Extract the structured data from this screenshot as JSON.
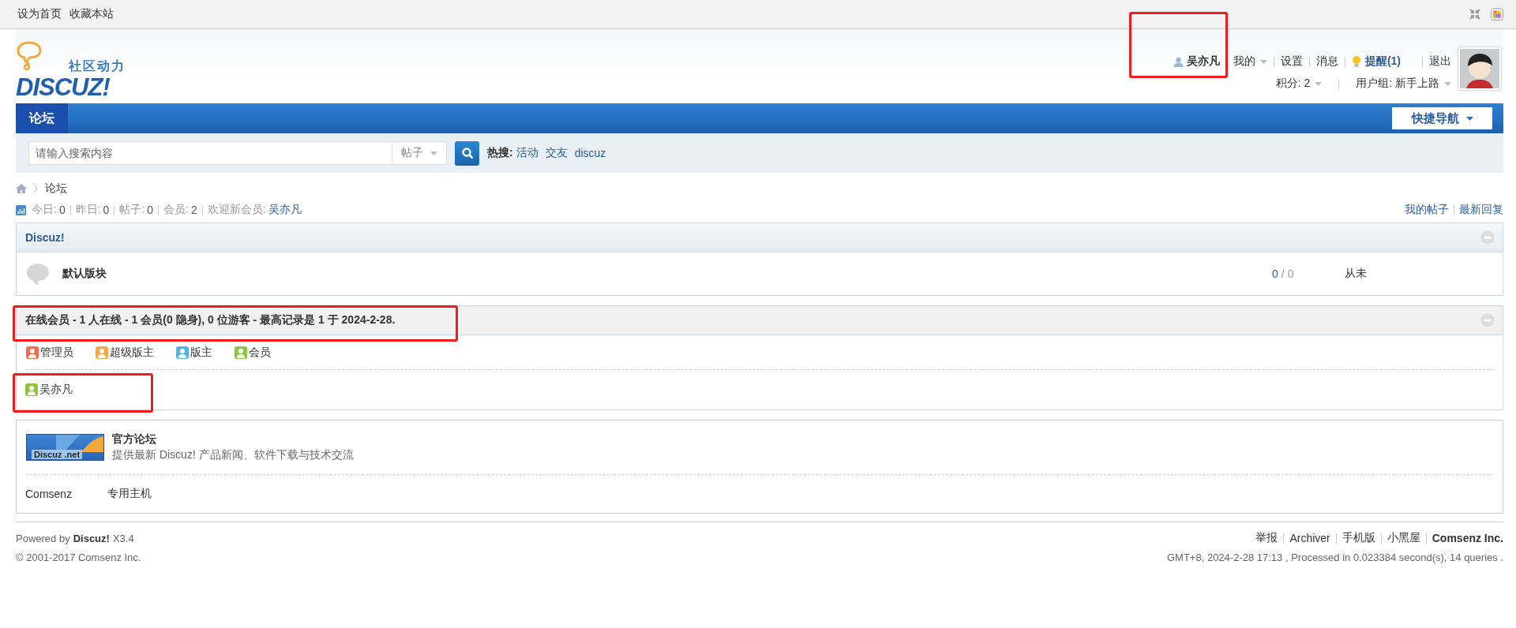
{
  "topbar": {
    "links": [
      "设为首页",
      "收藏本站"
    ]
  },
  "logo": {
    "tagline": "社区动力",
    "wordmark": "DISCUZ!"
  },
  "user": {
    "name": "吴亦凡",
    "highlighted": true,
    "links": [
      {
        "label": "我的",
        "kind": "menu"
      },
      {
        "label": "设置",
        "kind": "link"
      },
      {
        "label": "消息",
        "kind": "link"
      },
      {
        "label": "提醒(1)",
        "kind": "notice"
      },
      {
        "label": "退出",
        "kind": "link"
      }
    ],
    "credits": "积分: 2",
    "group": "用户组: 新手上路"
  },
  "nav": {
    "tabs": [
      {
        "label": "论坛",
        "selected": true
      }
    ],
    "quick_nav": "快捷导航"
  },
  "search": {
    "placeholder": "请输入搜索内容",
    "type": "帖子",
    "hot_label": "热搜:",
    "hot": [
      "活动",
      "交友",
      "discuz"
    ]
  },
  "breadcrumb": [
    "论坛"
  ],
  "stats": {
    "items": [
      {
        "label": "今日:",
        "value": "0"
      },
      {
        "label": "昨日:",
        "value": "0"
      },
      {
        "label": "帖子:",
        "value": "0"
      },
      {
        "label": "会员:",
        "value": "2"
      }
    ],
    "welcome": "欢迎新会员:",
    "new_member": "吴亦凡",
    "links": [
      "我的帖子",
      "最新回复"
    ]
  },
  "category": {
    "title": "Discuz!",
    "forums": [
      {
        "name": "默认版块",
        "threads": "0",
        "separator": "/",
        "posts": "0",
        "last": "从未"
      }
    ]
  },
  "online": {
    "title": "在线会员 - 1 人在线 - 1 会员(0 隐身), 0 位游客 - 最高记录是 1 于 2024-2-28.",
    "highlighted": true,
    "legend": [
      {
        "label": "管理员",
        "color": "#f26c4f"
      },
      {
        "label": "超级版主",
        "color": "#f7a844"
      },
      {
        "label": "版主",
        "color": "#4fb4e8"
      },
      {
        "label": "会员",
        "color": "#8cc63e"
      }
    ],
    "members": [
      {
        "name": "吴亦凡",
        "color": "#8cc63e",
        "highlighted": true
      }
    ]
  },
  "friend_links": {
    "featured": {
      "banner": "Discuz .net",
      "title": "官方论坛",
      "desc": "提供最新 Discuz! 产品新闻、软件下载与技术交流"
    },
    "text_links": [
      "Comsenz",
      "专用主机"
    ]
  },
  "footer": {
    "powered": "Powered by **Discuz!** X3.4",
    "copyright": "© 2001-2017 Comsenz Inc.",
    "links": [
      {
        "label": "举报",
        "bold": false
      },
      {
        "label": "Archiver",
        "bold": false
      },
      {
        "label": "手机版",
        "bold": false
      },
      {
        "label": "小黑屋",
        "bold": false
      },
      {
        "label": "Comsenz Inc.",
        "bold": true
      }
    ],
    "info": "GMT+8, 2024-2-28 17:13 , Processed in 0.023384 second(s), 14 queries ."
  }
}
